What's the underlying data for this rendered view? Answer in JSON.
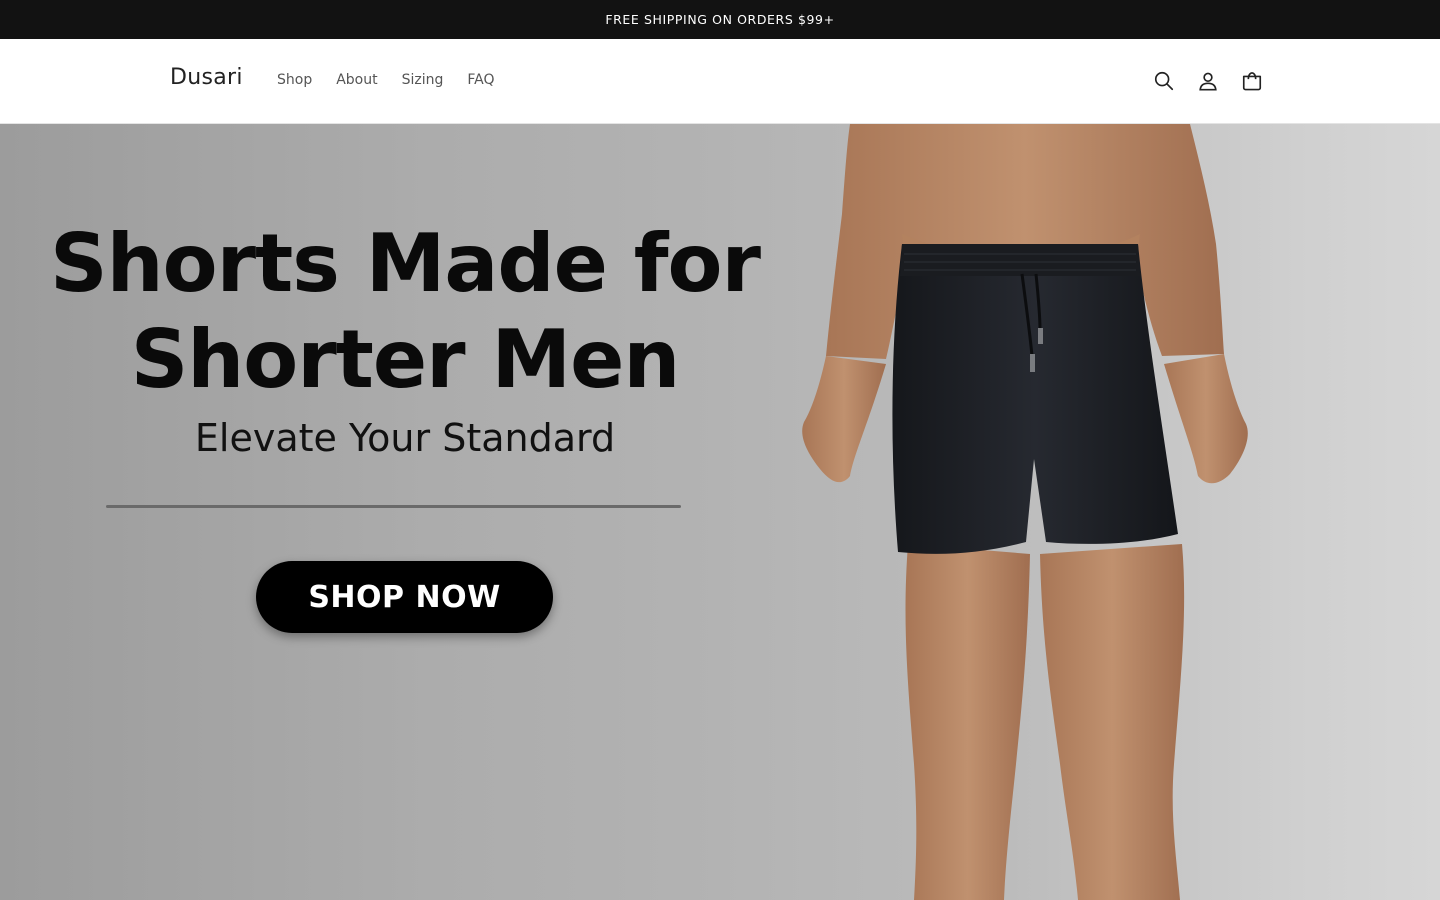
{
  "announcement": {
    "text": "FREE SHIPPING ON ORDERS $99+"
  },
  "header": {
    "logo": "Dusari",
    "nav": [
      "Shop",
      "About",
      "Sizing",
      "FAQ"
    ],
    "icons": [
      "search-icon",
      "account-icon",
      "cart-icon"
    ]
  },
  "hero": {
    "title_line1": "Shorts Made for",
    "title_line2": "Shorter Men",
    "subtitle": "Elevate Your Standard",
    "cta_label": "SHOP NOW",
    "image_subject": "shirtless man wearing black athletic shorts"
  },
  "colors": {
    "announcement_bg": "#121212",
    "button_bg": "#000000",
    "shorts": "#1e2025",
    "skin": "#b98563"
  }
}
